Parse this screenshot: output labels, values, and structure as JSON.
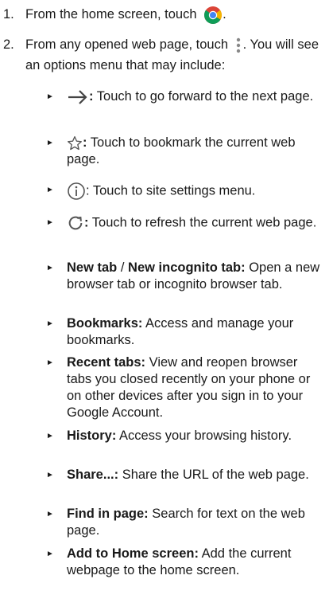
{
  "steps": [
    {
      "num": "1.",
      "before": "From the home screen, touch",
      "after": "."
    },
    {
      "num": "2.",
      "before": "From any opened web page, touch",
      "after": ". You will see an options menu that may include:"
    }
  ],
  "bullet_marker": "►",
  "icons": {
    "chrome": "chrome-icon",
    "more": "vertical-dots-icon",
    "forward": "forward-arrow-icon",
    "star": "bookmark-star-icon",
    "info": "info-icon",
    "refresh": "refresh-icon"
  },
  "menu_items": {
    "forward_sep": ":",
    "forward_text": " Touch to go forward to the next page.",
    "bookmark_sep": ":",
    "bookmark_text": " Touch to bookmark the current web page.",
    "info_text": ": Touch to site settings menu.",
    "refresh_sep": ":",
    "refresh_text": " Touch to refresh the current web page.",
    "newtab_label": "New tab",
    "newtab_slash": " / ",
    "incognito_label": "New incognito tab:",
    "newtab_text": " Open a new browser tab or incognito browser tab.",
    "bookmarks_label": "Bookmarks:",
    "bookmarks_text": " Access and manage your bookmarks.",
    "recent_label": "Recent tabs:",
    "recent_text": " View and reopen browser tabs you closed recently on your phone or on other devices after you sign in to your Google Account.",
    "history_label": "History:",
    "history_text": " Access your browsing history.",
    "share_label": "Share...:",
    "share_text": " Share the URL of the web page.",
    "find_label": "Find in page:",
    "find_text": " Search for text on the web page.",
    "add_label": "Add to Home screen:",
    "add_text": " Add the current webpage to the home screen."
  }
}
